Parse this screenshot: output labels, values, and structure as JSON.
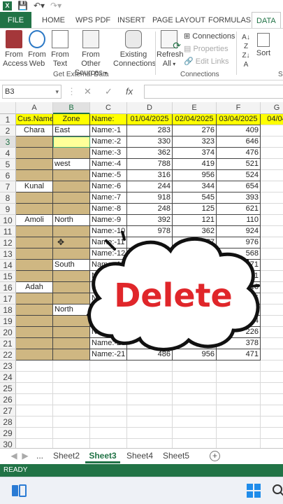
{
  "window": {
    "logo_text": "X",
    "save_icon": "save-icon",
    "undo_icon": "undo-icon",
    "redo_icon": "redo-icon"
  },
  "ribbon": {
    "tabs": [
      "FILE",
      "HOME",
      "WPS PDF",
      "INSERT",
      "PAGE LAYOUT",
      "FORMULAS",
      "DATA"
    ],
    "active_tab": "DATA",
    "buttons": {
      "from_access": [
        "From",
        "Access"
      ],
      "from_web": [
        "From",
        "Web"
      ],
      "from_text": [
        "From",
        "Text"
      ],
      "from_other": [
        "From Other",
        "Sources"
      ],
      "existing": [
        "Existing",
        "Connections"
      ],
      "refresh": [
        "Refresh",
        "All"
      ],
      "sort": "Sort"
    },
    "connections": [
      "Connections",
      "Properties",
      "Edit Links"
    ],
    "groups": [
      "Get External Data",
      "Connections",
      "S"
    ]
  },
  "formula_bar": {
    "name_box": "B3",
    "fx": "fx",
    "cancel": "✕",
    "enter": "✓"
  },
  "grid": {
    "columns": [
      "A",
      "B",
      "C",
      "D",
      "E",
      "F",
      "G"
    ],
    "selected_column": "B",
    "rows": [
      1,
      2,
      3,
      4,
      5,
      6,
      7,
      8,
      9,
      10,
      11,
      12,
      13,
      14,
      15,
      16,
      17,
      18,
      19,
      20,
      21,
      22,
      23,
      24,
      25,
      26,
      27,
      28,
      29,
      30,
      31
    ],
    "headers": [
      "Cus.Name",
      "Zone",
      "Name:",
      "01/04/2025",
      "02/04/2025",
      "03/04/2025",
      "04/04"
    ],
    "names": [
      "Name:-1",
      "Name:-2",
      "Name:-3",
      "Name:-4",
      "Name:-5",
      "Name:-6",
      "Name:-7",
      "Name:-8",
      "Name:-9",
      "Name:-10",
      "Name:-11",
      "Name:-12",
      "Name:-13",
      "Name:-14",
      "Name:-15",
      "Name:-16",
      "Name:-17",
      "Name:-18",
      "Name:-19",
      "Name:-20",
      "Name:-21"
    ],
    "col_a": {
      "2": "Chara",
      "7": "Kunal",
      "10": "Amoli",
      "16": "Adah"
    },
    "col_b": {
      "2": "East",
      "5": "west",
      "10": "North",
      "14": "South",
      "18": "North"
    },
    "values": [
      [
        "283",
        "276",
        "409"
      ],
      [
        "330",
        "323",
        "646"
      ],
      [
        "362",
        "374",
        "476"
      ],
      [
        "788",
        "419",
        "521"
      ],
      [
        "316",
        "956",
        "524"
      ],
      [
        "244",
        "344",
        "654"
      ],
      [
        "918",
        "545",
        "393"
      ],
      [
        "248",
        "125",
        "621"
      ],
      [
        "392",
        "121",
        "110"
      ],
      [
        "978",
        "362",
        "924"
      ],
      [
        "",
        "777",
        "976"
      ],
      [
        "",
        "983",
        "568"
      ],
      [
        "",
        "",
        "171"
      ],
      [
        "",
        "",
        "821"
      ],
      [
        "",
        "",
        "416"
      ],
      [
        "",
        "",
        "845"
      ],
      [
        "",
        "",
        "650"
      ],
      [
        "",
        "",
        "154"
      ],
      [
        "",
        "",
        "226"
      ],
      [
        "387",
        "99",
        "378"
      ],
      [
        "486",
        "956",
        "471"
      ]
    ]
  },
  "callout": {
    "text": "Delete"
  },
  "sheets": {
    "nav_prev": "◀",
    "nav_next": "▶",
    "ellipsis": "...",
    "tabs": [
      "Sheet2",
      "Sheet3",
      "Sheet4",
      "Sheet5"
    ],
    "active": "Sheet3",
    "add": "+"
  },
  "status": {
    "text": "READY"
  },
  "colors": {
    "excel_green": "#217346",
    "header_yellow": "#ffff00",
    "tan_fill": "#cfb782",
    "delete_red": "#e0262a"
  }
}
